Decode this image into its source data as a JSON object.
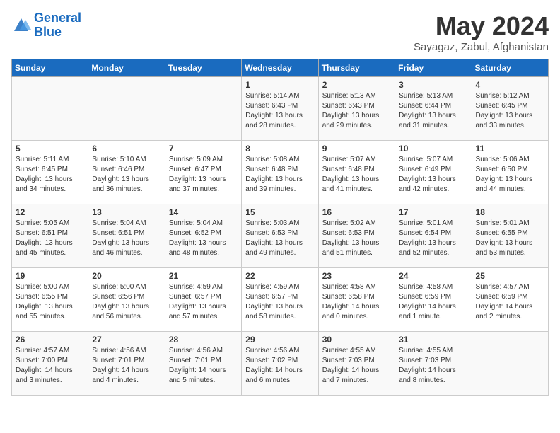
{
  "header": {
    "logo_line1": "General",
    "logo_line2": "Blue",
    "month": "May 2024",
    "location": "Sayagaz, Zabul, Afghanistan"
  },
  "days_of_week": [
    "Sunday",
    "Monday",
    "Tuesday",
    "Wednesday",
    "Thursday",
    "Friday",
    "Saturday"
  ],
  "weeks": [
    [
      {
        "day": "",
        "content": ""
      },
      {
        "day": "",
        "content": ""
      },
      {
        "day": "",
        "content": ""
      },
      {
        "day": "1",
        "content": "Sunrise: 5:14 AM\nSunset: 6:43 PM\nDaylight: 13 hours\nand 28 minutes."
      },
      {
        "day": "2",
        "content": "Sunrise: 5:13 AM\nSunset: 6:43 PM\nDaylight: 13 hours\nand 29 minutes."
      },
      {
        "day": "3",
        "content": "Sunrise: 5:13 AM\nSunset: 6:44 PM\nDaylight: 13 hours\nand 31 minutes."
      },
      {
        "day": "4",
        "content": "Sunrise: 5:12 AM\nSunset: 6:45 PM\nDaylight: 13 hours\nand 33 minutes."
      }
    ],
    [
      {
        "day": "5",
        "content": "Sunrise: 5:11 AM\nSunset: 6:45 PM\nDaylight: 13 hours\nand 34 minutes."
      },
      {
        "day": "6",
        "content": "Sunrise: 5:10 AM\nSunset: 6:46 PM\nDaylight: 13 hours\nand 36 minutes."
      },
      {
        "day": "7",
        "content": "Sunrise: 5:09 AM\nSunset: 6:47 PM\nDaylight: 13 hours\nand 37 minutes."
      },
      {
        "day": "8",
        "content": "Sunrise: 5:08 AM\nSunset: 6:48 PM\nDaylight: 13 hours\nand 39 minutes."
      },
      {
        "day": "9",
        "content": "Sunrise: 5:07 AM\nSunset: 6:48 PM\nDaylight: 13 hours\nand 41 minutes."
      },
      {
        "day": "10",
        "content": "Sunrise: 5:07 AM\nSunset: 6:49 PM\nDaylight: 13 hours\nand 42 minutes."
      },
      {
        "day": "11",
        "content": "Sunrise: 5:06 AM\nSunset: 6:50 PM\nDaylight: 13 hours\nand 44 minutes."
      }
    ],
    [
      {
        "day": "12",
        "content": "Sunrise: 5:05 AM\nSunset: 6:51 PM\nDaylight: 13 hours\nand 45 minutes."
      },
      {
        "day": "13",
        "content": "Sunrise: 5:04 AM\nSunset: 6:51 PM\nDaylight: 13 hours\nand 46 minutes."
      },
      {
        "day": "14",
        "content": "Sunrise: 5:04 AM\nSunset: 6:52 PM\nDaylight: 13 hours\nand 48 minutes."
      },
      {
        "day": "15",
        "content": "Sunrise: 5:03 AM\nSunset: 6:53 PM\nDaylight: 13 hours\nand 49 minutes."
      },
      {
        "day": "16",
        "content": "Sunrise: 5:02 AM\nSunset: 6:53 PM\nDaylight: 13 hours\nand 51 minutes."
      },
      {
        "day": "17",
        "content": "Sunrise: 5:01 AM\nSunset: 6:54 PM\nDaylight: 13 hours\nand 52 minutes."
      },
      {
        "day": "18",
        "content": "Sunrise: 5:01 AM\nSunset: 6:55 PM\nDaylight: 13 hours\nand 53 minutes."
      }
    ],
    [
      {
        "day": "19",
        "content": "Sunrise: 5:00 AM\nSunset: 6:55 PM\nDaylight: 13 hours\nand 55 minutes."
      },
      {
        "day": "20",
        "content": "Sunrise: 5:00 AM\nSunset: 6:56 PM\nDaylight: 13 hours\nand 56 minutes."
      },
      {
        "day": "21",
        "content": "Sunrise: 4:59 AM\nSunset: 6:57 PM\nDaylight: 13 hours\nand 57 minutes."
      },
      {
        "day": "22",
        "content": "Sunrise: 4:59 AM\nSunset: 6:57 PM\nDaylight: 13 hours\nand 58 minutes."
      },
      {
        "day": "23",
        "content": "Sunrise: 4:58 AM\nSunset: 6:58 PM\nDaylight: 14 hours\nand 0 minutes."
      },
      {
        "day": "24",
        "content": "Sunrise: 4:58 AM\nSunset: 6:59 PM\nDaylight: 14 hours\nand 1 minute."
      },
      {
        "day": "25",
        "content": "Sunrise: 4:57 AM\nSunset: 6:59 PM\nDaylight: 14 hours\nand 2 minutes."
      }
    ],
    [
      {
        "day": "26",
        "content": "Sunrise: 4:57 AM\nSunset: 7:00 PM\nDaylight: 14 hours\nand 3 minutes."
      },
      {
        "day": "27",
        "content": "Sunrise: 4:56 AM\nSunset: 7:01 PM\nDaylight: 14 hours\nand 4 minutes."
      },
      {
        "day": "28",
        "content": "Sunrise: 4:56 AM\nSunset: 7:01 PM\nDaylight: 14 hours\nand 5 minutes."
      },
      {
        "day": "29",
        "content": "Sunrise: 4:56 AM\nSunset: 7:02 PM\nDaylight: 14 hours\nand 6 minutes."
      },
      {
        "day": "30",
        "content": "Sunrise: 4:55 AM\nSunset: 7:03 PM\nDaylight: 14 hours\nand 7 minutes."
      },
      {
        "day": "31",
        "content": "Sunrise: 4:55 AM\nSunset: 7:03 PM\nDaylight: 14 hours\nand 8 minutes."
      },
      {
        "day": "",
        "content": ""
      }
    ]
  ]
}
